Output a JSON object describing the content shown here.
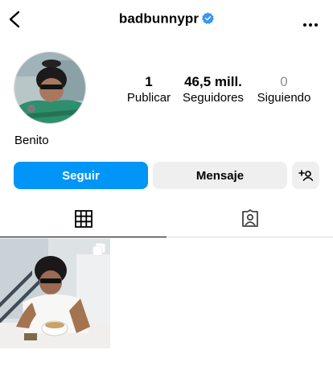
{
  "header": {
    "username": "badbunnypr",
    "verified": true
  },
  "profile": {
    "display_name": "Benito",
    "stats": {
      "posts_count": "1",
      "posts_label": "Publicar",
      "followers_count": "46,5 mill.",
      "followers_label": "Seguidores",
      "following_count": "0",
      "following_label": "Siguiendo"
    }
  },
  "actions": {
    "follow_label": "Seguir",
    "message_label": "Mensaje",
    "suggest_icon": "add-person-icon"
  },
  "tabs": [
    {
      "icon": "grid-icon",
      "active": true
    },
    {
      "icon": "tagged-icon",
      "active": false
    }
  ],
  "posts": [
    {
      "type": "carousel",
      "icon": "carousel-icon"
    }
  ],
  "colors": {
    "accent": "#0095f6",
    "verified": "#3897f0",
    "secondary_button": "#efefef",
    "muted_text": "#8e8e8e"
  }
}
